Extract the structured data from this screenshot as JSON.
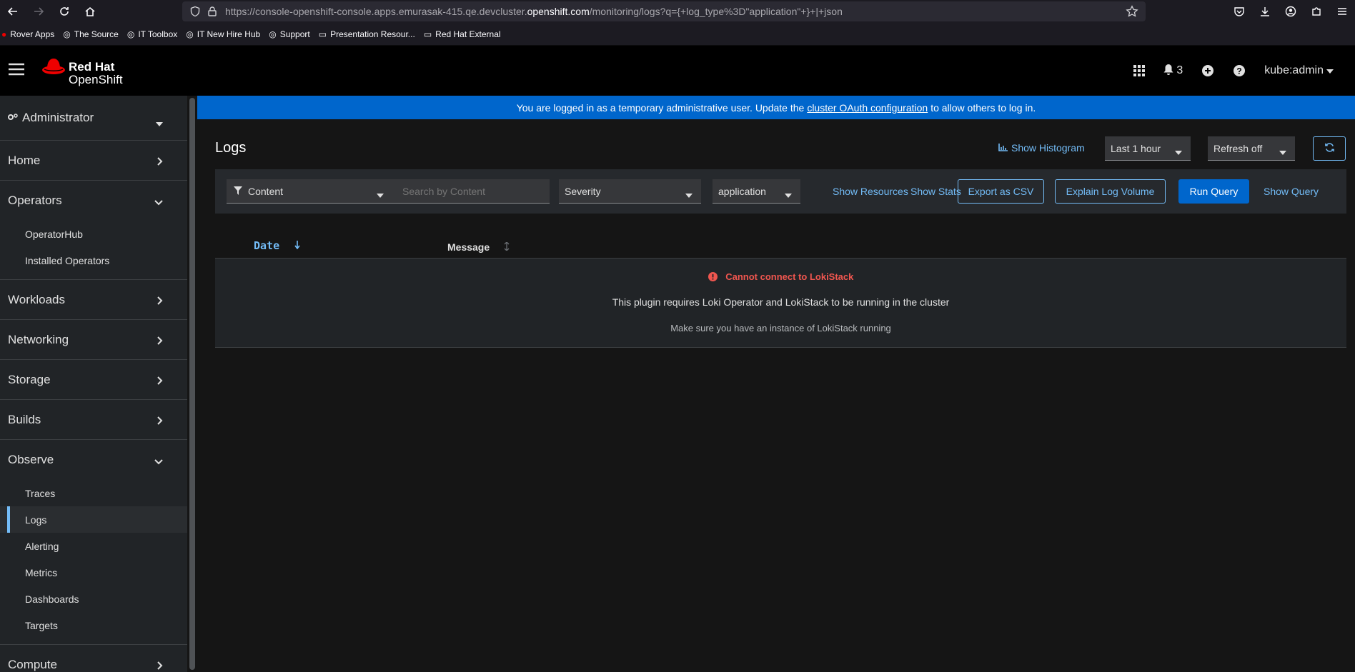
{
  "browser": {
    "url_prefix": "https://console-openshift-console.apps.emurasak-415.qe.devcluster.",
    "url_domain": "openshift.com",
    "url_suffix": "/monitoring/logs?q={+log_type%3D\"application\"+}+|+json",
    "bookmarks": [
      "Rover Apps",
      "The Source",
      "IT Toolbox",
      "IT New Hire Hub",
      "Support",
      "Presentation Resour...",
      "Red Hat External"
    ]
  },
  "masthead": {
    "brand_line1": "Red Hat",
    "brand_line2": "OpenShift",
    "notification_count": "3",
    "user": "kube:admin"
  },
  "banner": {
    "text_before": "You are logged in as a temporary administrative user. Update the",
    "link": "cluster OAuth configuration",
    "text_after": "to allow others to log in."
  },
  "sidebar": {
    "perspective": "Administrator",
    "home": "Home",
    "operators": "Operators",
    "operators_items": [
      "OperatorHub",
      "Installed Operators"
    ],
    "workloads": "Workloads",
    "networking": "Networking",
    "storage": "Storage",
    "builds": "Builds",
    "observe": "Observe",
    "observe_items": [
      "Traces",
      "Logs",
      "Alerting",
      "Metrics",
      "Dashboards",
      "Targets"
    ],
    "compute": "Compute"
  },
  "page": {
    "title": "Logs",
    "show_histogram": "Show Histogram",
    "time_range": "Last 1 hour",
    "refresh": "Refresh off"
  },
  "toolbar": {
    "filter_attribute": "Content",
    "search_placeholder": "Search by Content",
    "severity": "Severity",
    "tenant": "application",
    "show_resources": "Show Resources",
    "show_stats": "Show Stats",
    "export_csv": "Export as CSV",
    "explain_volume": "Explain Log Volume",
    "run_query": "Run Query",
    "show_query": "Show Query"
  },
  "table": {
    "col_date": "Date",
    "col_message": "Message",
    "error_title": "Cannot connect to LokiStack",
    "error_body": "This plugin requires Loki Operator and LokiStack to be running in the cluster",
    "error_hint": "Make sure you have an instance of LokiStack running"
  },
  "colors": {
    "accent": "#73bcf7",
    "primary": "#0066cc",
    "danger": "#f0564f"
  }
}
